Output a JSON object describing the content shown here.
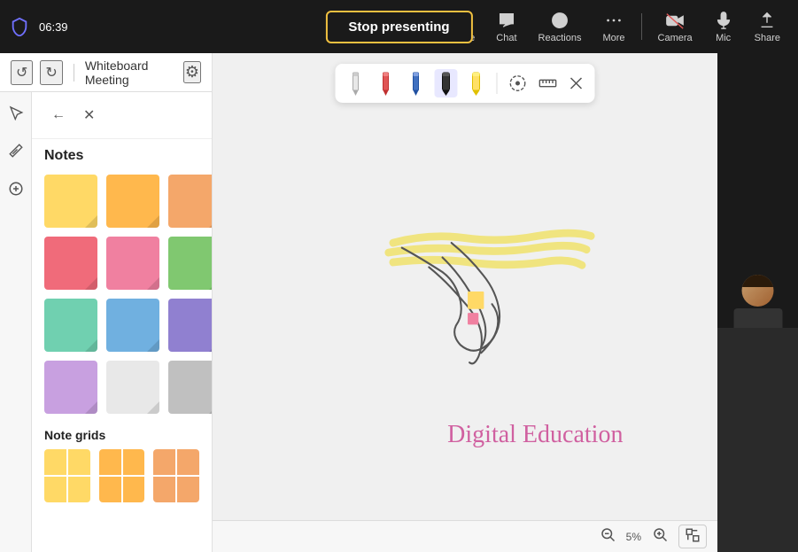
{
  "topbar": {
    "time": "06:39",
    "stop_presenting_label": "Stop presenting",
    "nav_items": [
      {
        "id": "people",
        "label": "People"
      },
      {
        "id": "chat",
        "label": "Chat"
      },
      {
        "id": "reactions",
        "label": "Reactions"
      },
      {
        "id": "more",
        "label": "More"
      },
      {
        "id": "camera",
        "label": "Camera"
      },
      {
        "id": "mic",
        "label": "Mic"
      },
      {
        "id": "share",
        "label": "Share"
      }
    ]
  },
  "second_bar": {
    "title": "Whiteboard Meeting",
    "settings_tooltip": "Settings"
  },
  "panel": {
    "back_label": "Back",
    "close_label": "Close",
    "notes_label": "Notes",
    "note_grids_label": "Note grids",
    "notes": [
      {
        "color": "note-yellow-1",
        "label": "Yellow note"
      },
      {
        "color": "note-yellow-2",
        "label": "Yellow-orange note"
      },
      {
        "color": "note-orange",
        "label": "Orange note"
      },
      {
        "color": "note-red",
        "label": "Red note"
      },
      {
        "color": "note-pink",
        "label": "Pink note"
      },
      {
        "color": "note-green",
        "label": "Green note"
      },
      {
        "color": "note-teal",
        "label": "Teal note"
      },
      {
        "color": "note-blue",
        "label": "Blue note"
      },
      {
        "color": "note-purple",
        "label": "Purple note"
      },
      {
        "color": "note-lavender",
        "label": "Lavender note"
      },
      {
        "color": "note-gray-light",
        "label": "Light gray note"
      },
      {
        "color": "note-gray",
        "label": "Gray note"
      }
    ]
  },
  "zoom": {
    "level": "5%",
    "zoom_in_label": "+",
    "zoom_out_label": "-"
  },
  "canvas": {
    "digital_education_text": "Digital Education"
  },
  "drawing_tools": [
    {
      "id": "pencil-white",
      "label": "White pencil"
    },
    {
      "id": "pencil-red",
      "label": "Red pencil"
    },
    {
      "id": "pencil-blue",
      "label": "Blue pencil"
    },
    {
      "id": "marker-black",
      "label": "Black marker"
    },
    {
      "id": "marker-yellow",
      "label": "Yellow marker"
    },
    {
      "id": "lasso",
      "label": "Lasso select"
    },
    {
      "id": "ruler",
      "label": "Ruler"
    },
    {
      "id": "close-tools",
      "label": "Close tools"
    }
  ]
}
